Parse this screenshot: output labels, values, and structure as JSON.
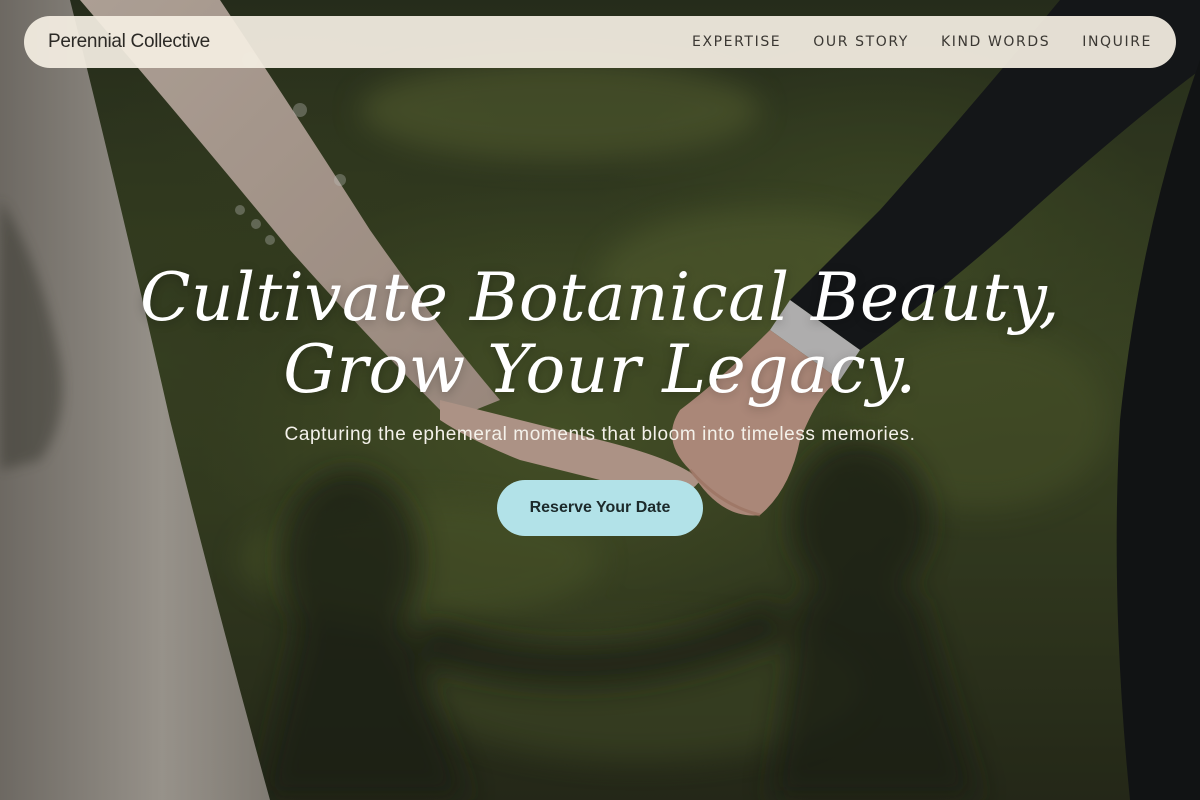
{
  "brand": {
    "name": "Perennial Collective"
  },
  "nav": {
    "items": [
      {
        "label": "EXPERTISE"
      },
      {
        "label": "OUR STORY"
      },
      {
        "label": "KIND WORDS"
      },
      {
        "label": "INQUIRE"
      }
    ]
  },
  "hero": {
    "headline_line1": "Cultivate Botanical Beauty,",
    "headline_line2": "Grow Your Legacy.",
    "tagline": "Capturing the ephemeral moments that bloom into timeless memories.",
    "cta_label": "Reserve Your Date"
  },
  "colors": {
    "nav_background": "#f4eee2",
    "cta_background": "#b2e2e8",
    "headline_text": "#ffffff"
  }
}
